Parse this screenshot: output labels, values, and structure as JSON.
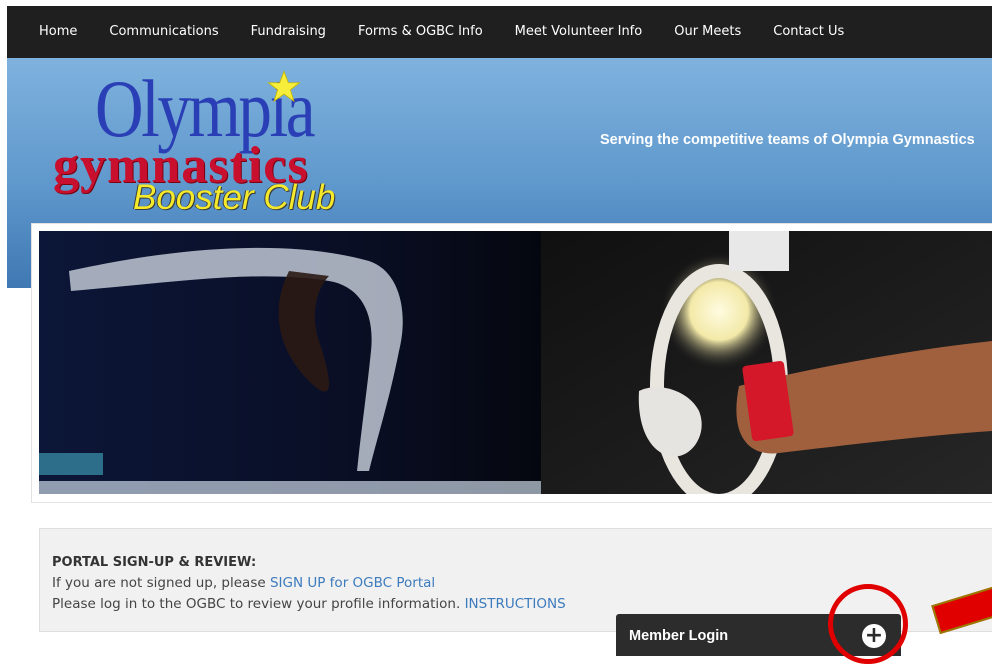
{
  "nav": {
    "items": [
      {
        "label": "Home"
      },
      {
        "label": "Communications"
      },
      {
        "label": "Fundraising"
      },
      {
        "label": "Forms & OGBC Info"
      },
      {
        "label": "Meet Volunteer Info"
      },
      {
        "label": "Our Meets"
      },
      {
        "label": "Contact Us"
      }
    ]
  },
  "header": {
    "logo_line1": "Olympia",
    "logo_line2": "gymnastics",
    "logo_line3": "Booster Club",
    "tagline": "Serving the competitive teams of Olympia Gymnastics"
  },
  "portal": {
    "title": "PORTAL SIGN-UP & REVIEW:",
    "line1_text": "If you are not signed up, please ",
    "line1_link": "SIGN UP for OGBC Portal",
    "line2_text": "Please log in to the OGBC to review your profile information. ",
    "line2_link": "INSTRUCTIONS"
  },
  "login": {
    "title": "Member Login",
    "toggle": "+"
  },
  "colors": {
    "nav_bg": "#1f1f1f",
    "banner_blue": "#5f98cc",
    "link_blue": "#3c7bbd",
    "annotation_red": "#e00000"
  }
}
